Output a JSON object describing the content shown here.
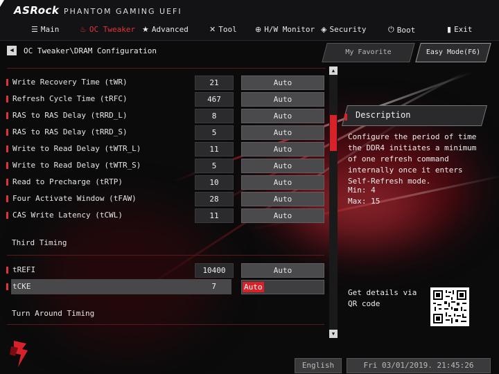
{
  "header": {
    "brand": "ASRock",
    "subtitle": "PHANTOM GAMING UEFI"
  },
  "nav": [
    {
      "icon": "grid-icon",
      "label": "Main",
      "active": false
    },
    {
      "icon": "flame-icon",
      "label": "OC Tweaker",
      "active": true
    },
    {
      "icon": "star-icon",
      "label": "Advanced",
      "active": false
    },
    {
      "icon": "tools-icon",
      "label": "Tool",
      "active": false
    },
    {
      "icon": "globe-icon",
      "label": "H/W Monitor",
      "active": false
    },
    {
      "icon": "shield-icon",
      "label": "Security",
      "active": false
    },
    {
      "icon": "power-icon",
      "label": "Boot",
      "active": false
    },
    {
      "icon": "exit-icon",
      "label": "Exit",
      "active": false
    }
  ],
  "breadcrumb": "OC Tweaker\\DRAM Configuration",
  "buttons": {
    "favorite": "My Favorite",
    "easy_mode": "Easy Mode(F6)"
  },
  "rows": [
    {
      "label": "Write Recovery Time (tWR)",
      "value": "21",
      "setting": "Auto"
    },
    {
      "label": "Refresh Cycle Time (tRFC)",
      "value": "467",
      "setting": "Auto"
    },
    {
      "label": "RAS to RAS Delay (tRRD_L)",
      "value": "8",
      "setting": "Auto"
    },
    {
      "label": "RAS to RAS Delay (tRRD_S)",
      "value": "5",
      "setting": "Auto"
    },
    {
      "label": "Write to Read Delay (tWTR_L)",
      "value": "11",
      "setting": "Auto"
    },
    {
      "label": "Write to Read Delay (tWTR_S)",
      "value": "5",
      "setting": "Auto"
    },
    {
      "label": "Read to Precharge (tRTP)",
      "value": "10",
      "setting": "Auto"
    },
    {
      "label": "Four Activate Window (tFAW)",
      "value": "28",
      "setting": "Auto"
    },
    {
      "label": "CAS Write Latency (tCWL)",
      "value": "11",
      "setting": "Auto"
    }
  ],
  "third_timing": {
    "title": "Third Timing",
    "rows": [
      {
        "label": "tREFI",
        "value": "10400",
        "setting": "Auto"
      },
      {
        "label": "tCKE",
        "value": "7",
        "setting": "Auto",
        "selected": true
      }
    ]
  },
  "turn_around": {
    "title": "Turn Around Timing"
  },
  "description": {
    "title": "Description",
    "text": "Configure the period of time the DDR4 initiates a minimum of one refresh command internally once it enters Self-Refresh mode.",
    "min": "Min: 4",
    "max": "Max: 15"
  },
  "qr": {
    "text": "Get details via QR code"
  },
  "footer": {
    "language": "English",
    "datetime": "Fri 03/01/2019. 21:45:26"
  },
  "colors": {
    "accent": "#d8222a",
    "background": "#0b0b0c"
  }
}
